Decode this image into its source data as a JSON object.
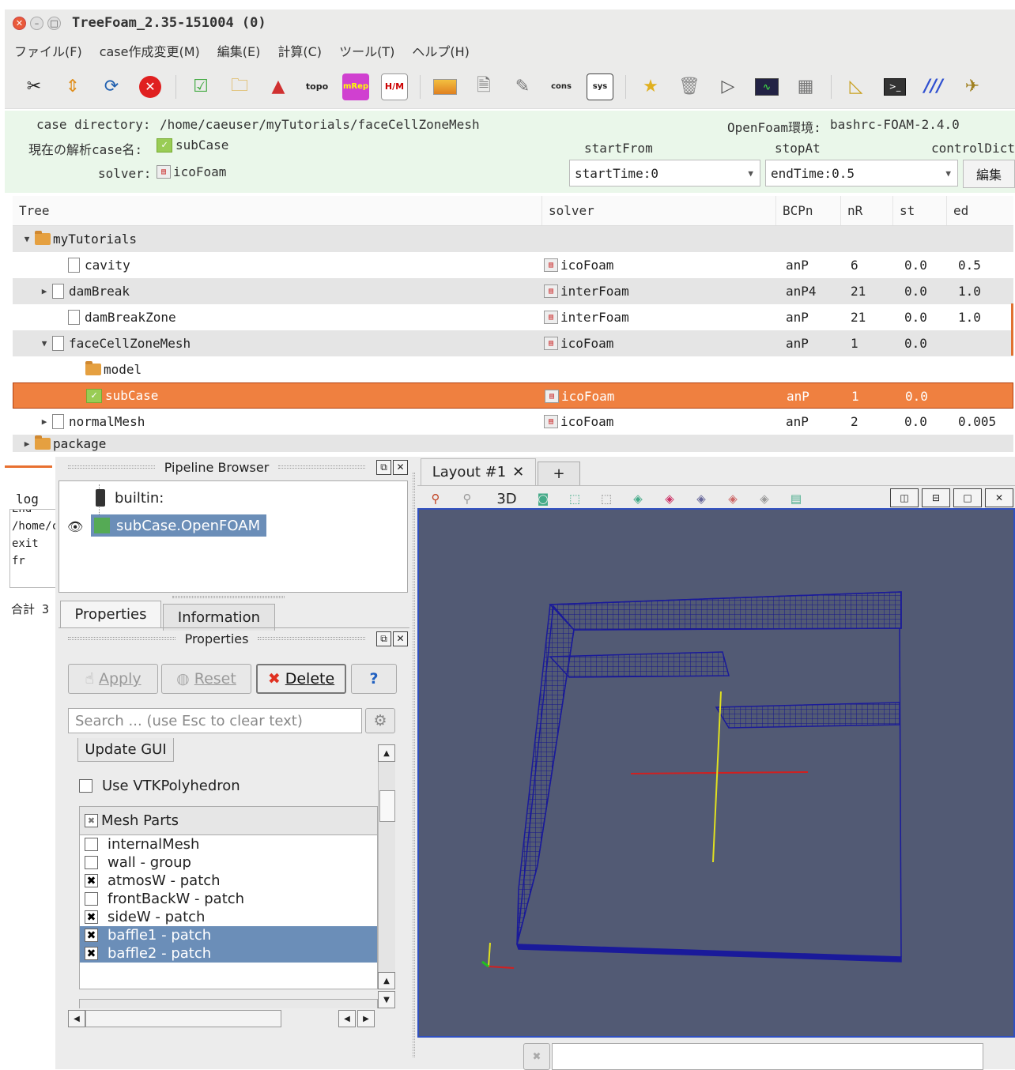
{
  "window": {
    "title": "TreeFoam_2.35-151004 (0)"
  },
  "menu": [
    "ファイル(F)",
    "case作成変更(M)",
    "編集(E)",
    "計算(C)",
    "ツール(T)",
    "ヘルプ(H)"
  ],
  "toolbar": {
    "icons": [
      "tools-icon",
      "updown-arrow-icon",
      "refresh-icon",
      "stop-icon",
      "check-doc-icon",
      "folder-search-icon",
      "mesh-icon",
      "topo-icon",
      "mRep-icon",
      "hatch-icon",
      "bar-chart-icon",
      "document-icon",
      "edit-doc-icon",
      "cons-icon",
      "sys-icon",
      "star-doc-icon",
      "trash-icon",
      "play-icon",
      "monitor-icon",
      "grid-icon",
      "triangle-icon",
      "terminal-icon",
      "paraview-icon",
      "bird-icon"
    ],
    "labels": {
      "topo": "topo",
      "mRep": "mRep",
      "hatch": "H/M",
      "cons": "cons",
      "sys": "sys"
    }
  },
  "info": {
    "case_dir_label": "case directory:",
    "case_dir": "/home/caeuser/myTutorials/faceCellZoneMesh",
    "openfoam_label": "OpenFoam環境:",
    "openfoam": "bashrc-FOAM-2.4.0",
    "case_name_label": "現在の解析case名:",
    "case_name": "subCase",
    "solver_label": "solver:",
    "solver": "icoFoam",
    "startFrom_label": "startFrom",
    "startFrom": "startTime:0",
    "stopAt_label": "stopAt",
    "stopAt": "endTime:0.5",
    "controlDict_label": "controlDict",
    "edit_button": "編集"
  },
  "tree": {
    "headers": [
      "Tree",
      "solver",
      "BCPn",
      "nR",
      "st",
      "ed"
    ],
    "rows": [
      {
        "name": "myTutorials",
        "solver": "",
        "bcpn": "",
        "nr": "",
        "st": "",
        "ed": ""
      },
      {
        "name": "cavity",
        "solver": "icoFoam",
        "bcpn": "anP",
        "nr": "6",
        "st": "0.0",
        "ed": "0.5"
      },
      {
        "name": "damBreak",
        "solver": "interFoam",
        "bcpn": "anP4",
        "nr": "21",
        "st": "0.0",
        "ed": "1.0"
      },
      {
        "name": "damBreakZone",
        "solver": "interFoam",
        "bcpn": "anP",
        "nr": "21",
        "st": "0.0",
        "ed": "1.0"
      },
      {
        "name": "faceCellZoneMesh",
        "solver": "icoFoam",
        "bcpn": "anP",
        "nr": "1",
        "st": "0.0",
        "ed": ""
      },
      {
        "name": "model",
        "solver": "",
        "bcpn": "",
        "nr": "",
        "st": "",
        "ed": ""
      },
      {
        "name": "subCase",
        "solver": "icoFoam",
        "bcpn": "anP",
        "nr": "1",
        "st": "0.0",
        "ed": ""
      },
      {
        "name": "normalMesh",
        "solver": "icoFoam",
        "bcpn": "anP",
        "nr": "2",
        "st": "0.0",
        "ed": "0.005"
      },
      {
        "name": "package",
        "solver": "",
        "bcpn": "",
        "nr": "",
        "st": "",
        "ed": ""
      }
    ]
  },
  "log": {
    "label": "log",
    "lines": [
      "End",
      "/home/c",
      "exit fr"
    ],
    "total": "合計 3"
  },
  "pipeline": {
    "title": "Pipeline Browser",
    "builtin": "builtin:",
    "source": "subCase.OpenFOAM"
  },
  "tabs": {
    "properties": "Properties",
    "information": "Information"
  },
  "properties": {
    "title": "Properties",
    "apply": "Apply",
    "reset": "Reset",
    "delete": "Delete",
    "help": "?",
    "search_placeholder": "Search ... (use Esc to clear text)",
    "update_gui": "Update GUI",
    "use_vtk": "Use VTKPolyhedron",
    "mesh_parts": "Mesh Parts",
    "parts": [
      {
        "label": "internalMesh",
        "checked": false,
        "selected": false
      },
      {
        "label": "wall - group",
        "checked": false,
        "selected": false
      },
      {
        "label": "atmosW - patch",
        "checked": true,
        "selected": false
      },
      {
        "label": "frontBackW - patch",
        "checked": false,
        "selected": false
      },
      {
        "label": "sideW - patch",
        "checked": true,
        "selected": false
      },
      {
        "label": "baffle1 - patch",
        "checked": true,
        "selected": true
      },
      {
        "label": "baffle2 - patch",
        "checked": true,
        "selected": true
      }
    ]
  },
  "layout": {
    "tab": "Layout #1",
    "plus": "+",
    "mode": "3D"
  },
  "colors": {
    "selection": "#ef8040",
    "info_bg": "#eaf7ea",
    "view_bg": "#525a74",
    "mesh": "#1a1a9a"
  }
}
